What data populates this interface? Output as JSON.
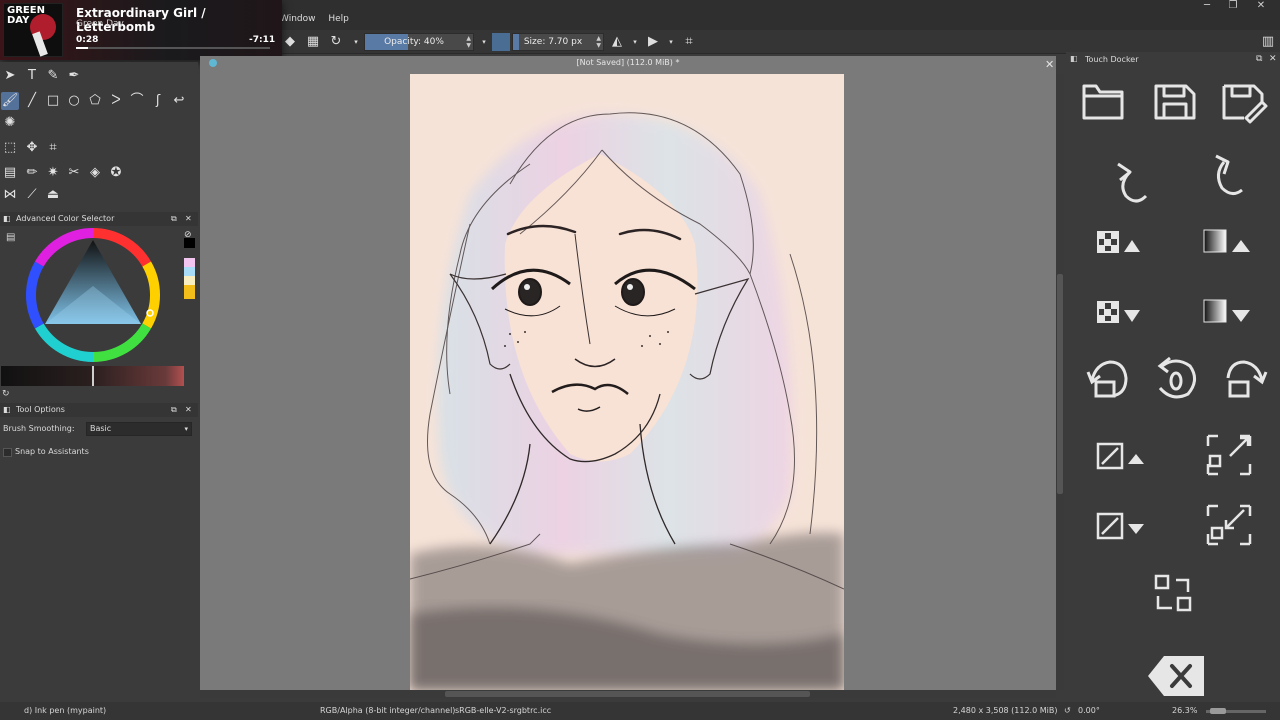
{
  "app": {
    "menu": [
      "Window",
      "Help"
    ],
    "document_title": "[Not Saved]  (112.0 MiB) *"
  },
  "media": {
    "song": "Extraordinary Girl / Letterbomb",
    "artist": "Green Day",
    "elapsed": "0:28",
    "remaining": "-7:11",
    "progress": 0.06,
    "album_text": "GREEN DAY"
  },
  "toolbar": {
    "opacity_label": "Opacity: 40%",
    "opacity_value": 0.4,
    "size_label": "Size: 7.70 px",
    "size_value": 0.07,
    "fg_color": "#4a6d94"
  },
  "panels": {
    "color_selector_title": "Advanced Color Selector",
    "tool_options_title": "Tool Options",
    "brush_smoothing_label": "Brush Smoothing:",
    "brush_smoothing_value": "Basic",
    "snap_label": "Snap to Assistants"
  },
  "touch_docker": {
    "title": "Touch Docker",
    "buttons": [
      "open-file-icon",
      "save-icon",
      "save-as-icon",
      "undo-icon",
      "redo-icon",
      "decrease-opacity-icon",
      "gradient-up-icon",
      "increase-opacity-icon",
      "gradient-down-icon",
      "rotate-left-icon",
      "reset-rotation-icon",
      "rotate-right-icon",
      "brush-size-up-icon",
      "fullscreen-icon",
      "brush-size-down-icon",
      "exit-fullscreen-icon",
      "swap-colors-icon",
      "clear-icon"
    ]
  },
  "status": {
    "brush": "d) Ink pen (mypaint)",
    "color_model": "RGB/Alpha (8-bit integer/channel)",
    "profile": "sRGB-elle-V2-srgbtrc.icc",
    "dimensions": "2,480 x 3,508 (112.0 MiB)",
    "rotation": "0.00°",
    "zoom": "26.3%"
  },
  "colors": {
    "accent": "#5a7aa6",
    "paper": "#f6e3d8",
    "background": "#3b3b3b"
  }
}
